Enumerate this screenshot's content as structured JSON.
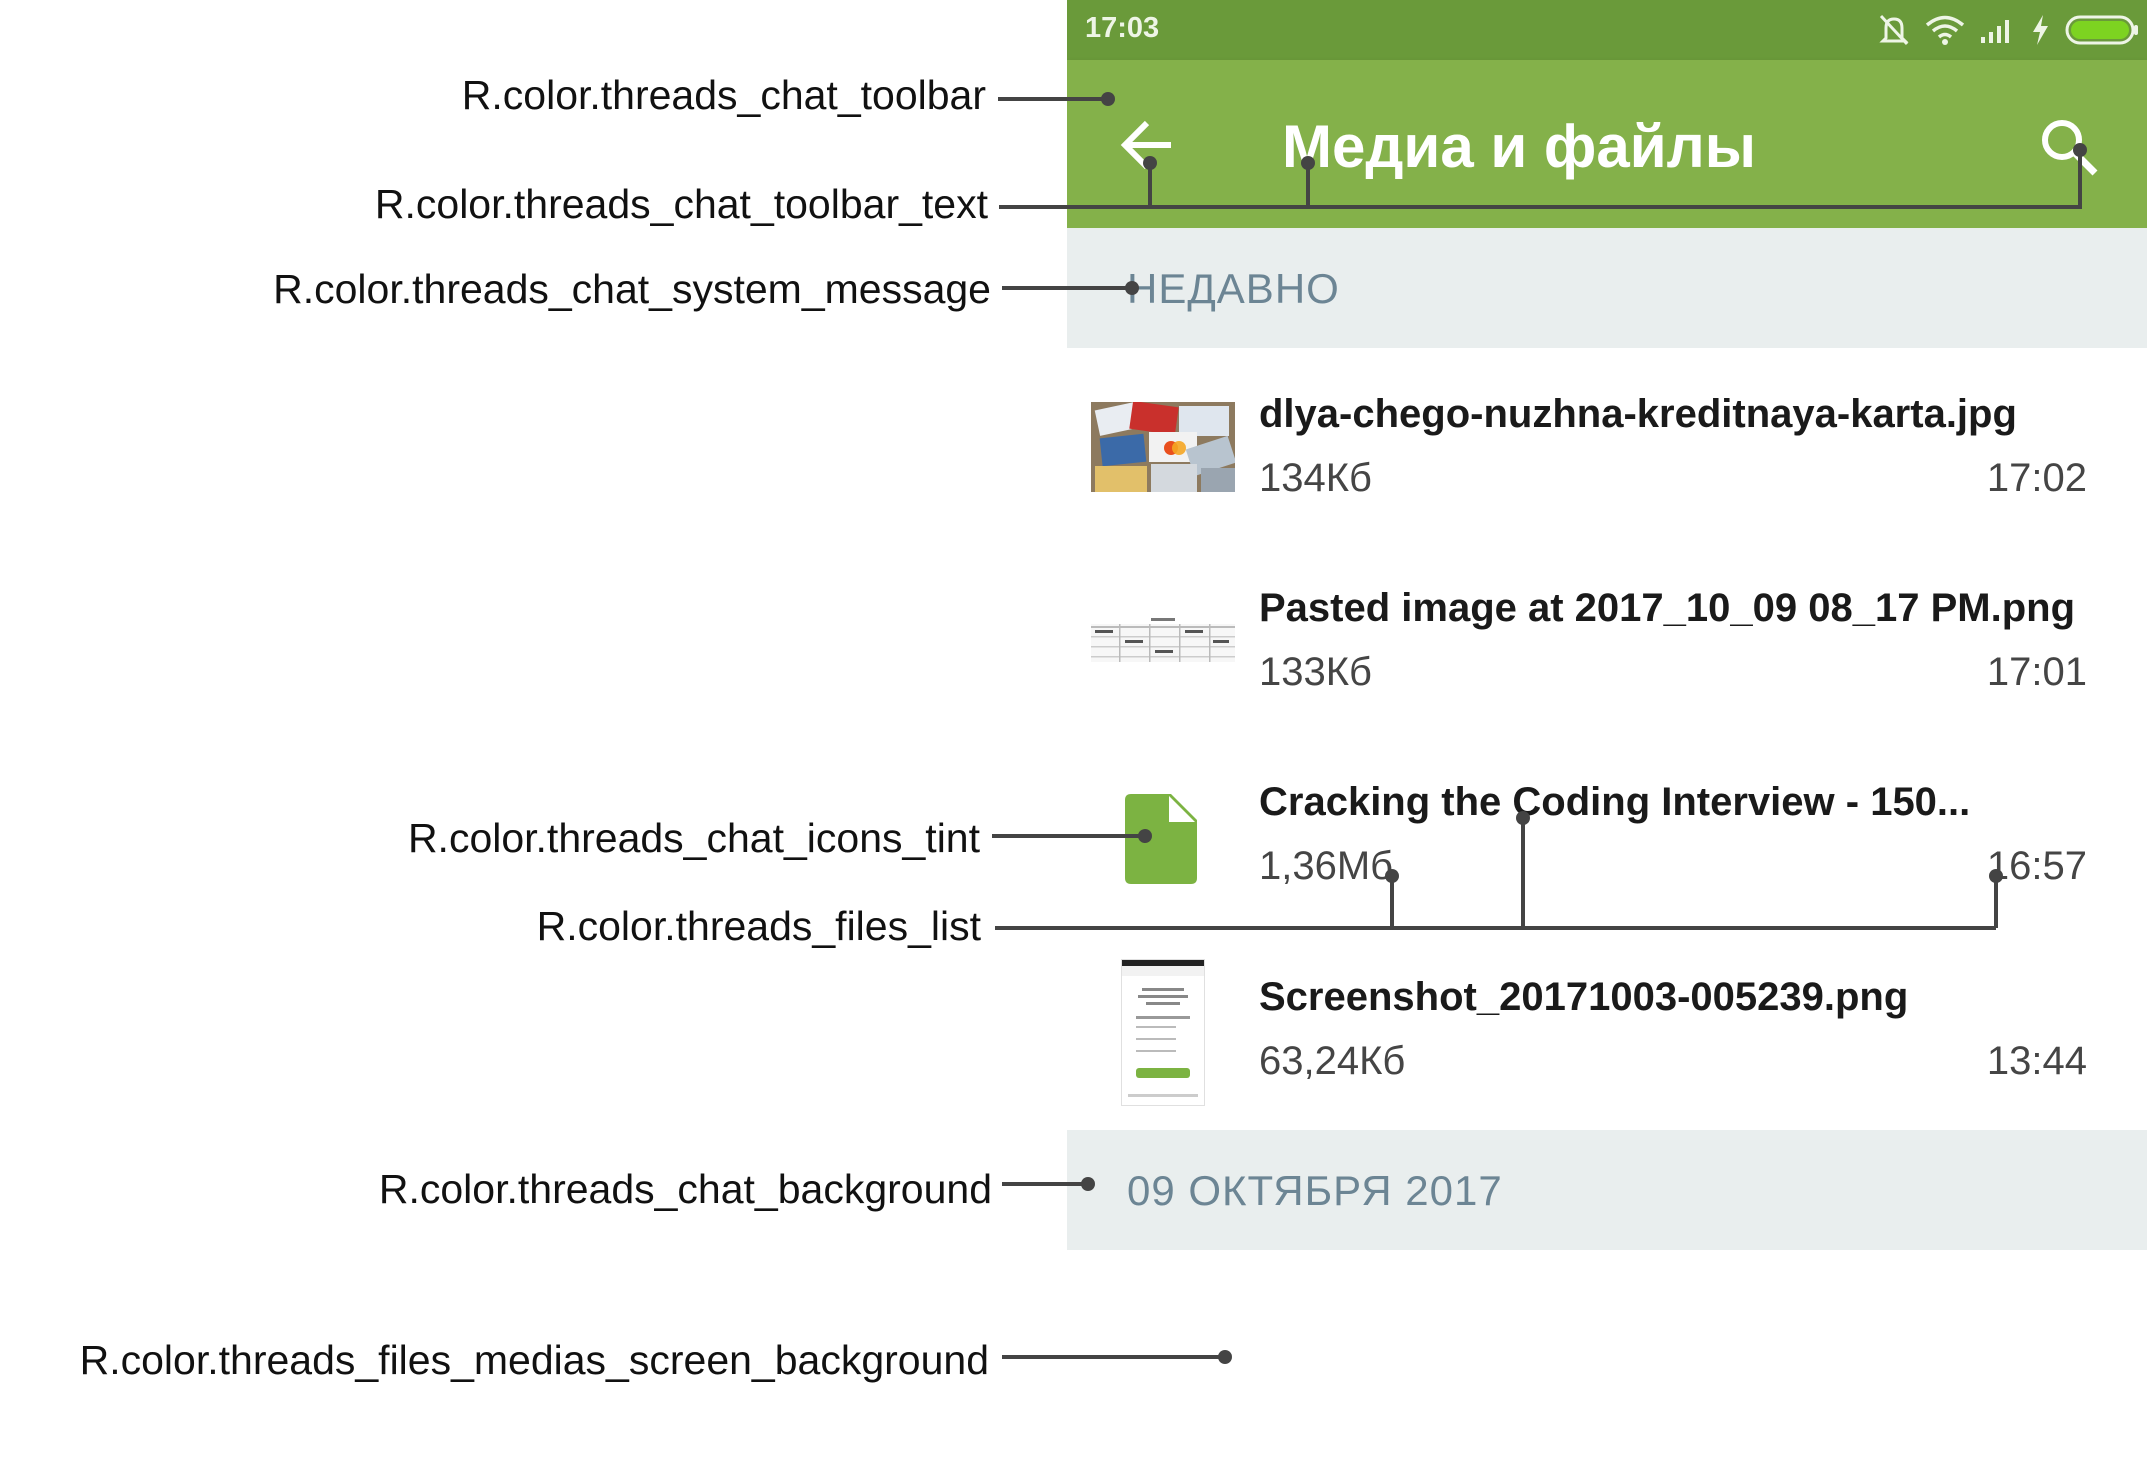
{
  "statusbar": {
    "time": "17:03",
    "icons": [
      "bell-off-icon",
      "wifi-icon",
      "signal-icon",
      "charging-icon",
      "battery-icon"
    ]
  },
  "toolbar": {
    "title": "Медиа и файлы",
    "back_icon": "arrow-left-icon",
    "search_icon": "search-icon"
  },
  "sections": [
    {
      "label": "НЕДАВНО"
    },
    {
      "label": "09 ОКТЯБРЯ 2017"
    }
  ],
  "files": [
    {
      "name": "dlya-chego-nuzhna-kreditnaya-karta.jpg",
      "size": "134Кб",
      "time": "17:02",
      "thumb": "photo-thumbnail"
    },
    {
      "name": "Pasted image at 2017_10_09 08_17 PM.png",
      "size": "133Кб",
      "time": "17:01",
      "thumb": "table-screenshot-thumbnail"
    },
    {
      "name": "Cracking the Coding Interview - 150...",
      "size": "1,36Мб",
      "time": "16:57",
      "thumb": "file-icon"
    },
    {
      "name": "Screenshot_20171003-005239.png",
      "size": "63,24Кб",
      "time": "13:44",
      "thumb": "phone-screenshot-thumbnail"
    }
  ],
  "annotations": {
    "toolbar": "R.color.threads_chat_toolbar",
    "toolbar_text": "R.color.threads_chat_toolbar_text",
    "system_message": "R.color.threads_chat_system_message",
    "icons_tint": "R.color.threads_chat_icons_tint",
    "files_list": "R.color.threads_files_list",
    "chat_background": "R.color.threads_chat_background",
    "screen_background": "R.color.threads_files_medias_screen_background"
  },
  "colors": {
    "statusbar": "#6a9a3a",
    "toolbar": "#84b14a",
    "toolbar_text": "#ffffff",
    "section_bg": "#e9eeee",
    "section_text": "#6c8594",
    "icon_tint": "#7cb342",
    "annotation_line": "#444444"
  }
}
